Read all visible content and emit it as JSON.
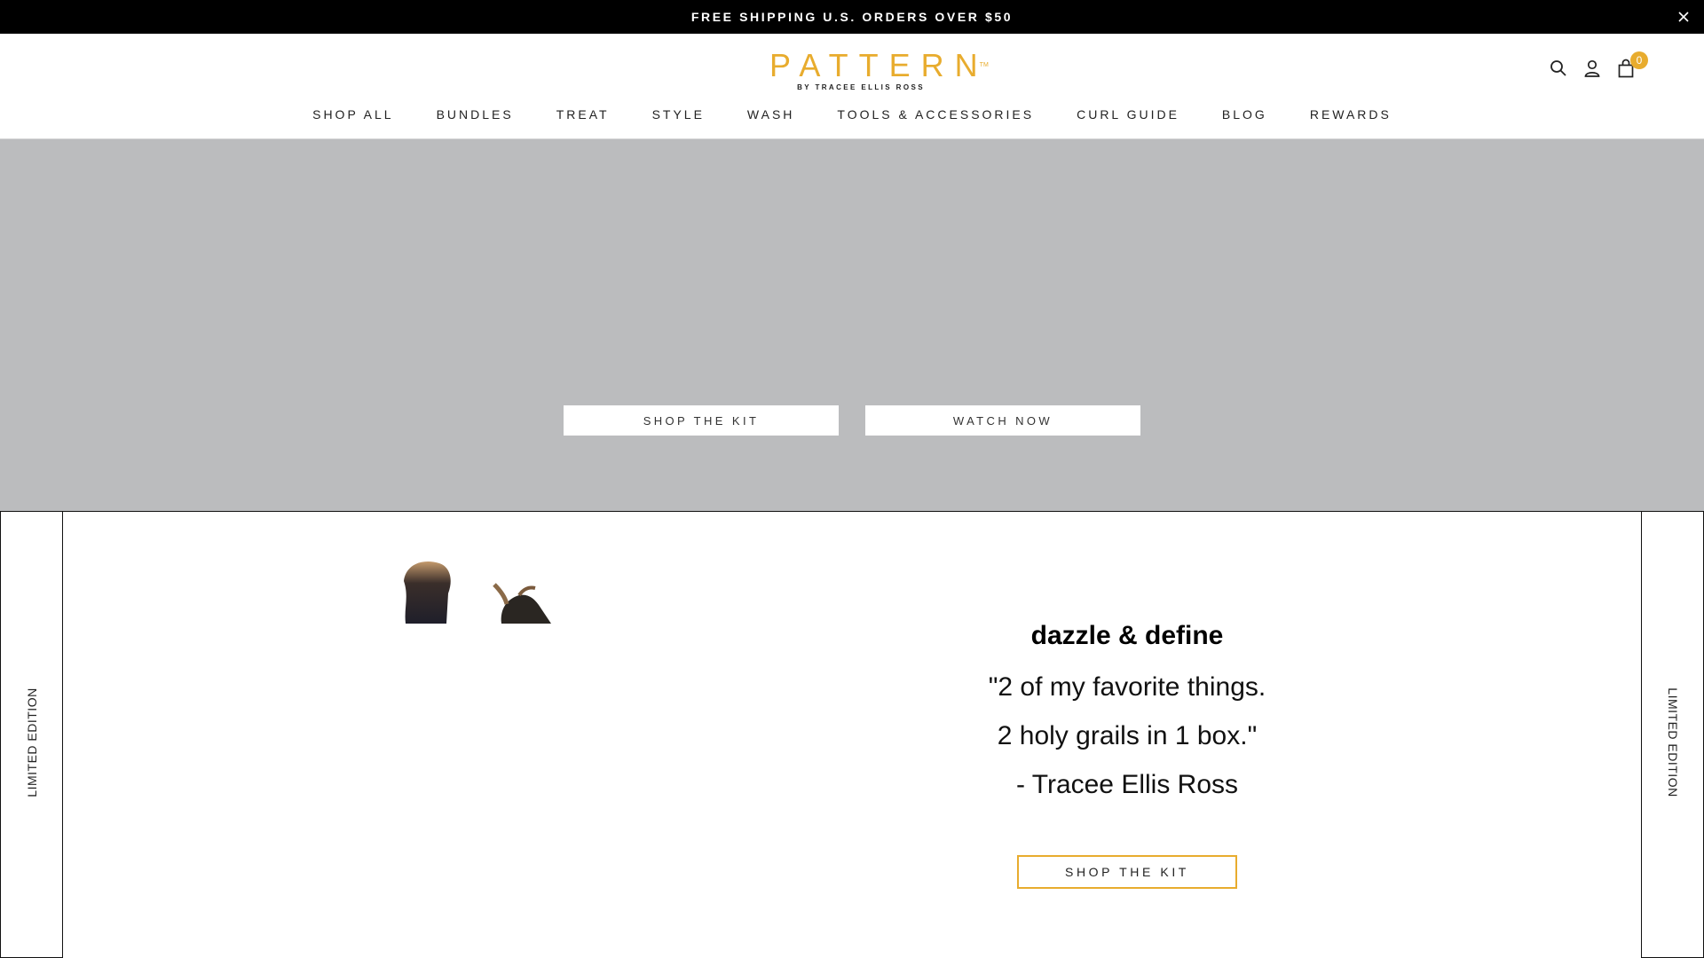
{
  "announcement": {
    "text": "FREE SHIPPING U.S. ORDERS OVER $50",
    "close_icon": "close-icon"
  },
  "brand": {
    "name": "PATTERN",
    "tm": "TM",
    "tagline": "BY TRACEE ELLIS ROSS",
    "color": "#e8ac2e"
  },
  "header": {
    "icons": [
      "search-icon",
      "account-icon",
      "cart-icon"
    ],
    "cart_count": "0"
  },
  "nav": {
    "items": [
      {
        "label": "SHOP ALL"
      },
      {
        "label": "BUNDLES"
      },
      {
        "label": "TREAT"
      },
      {
        "label": "STYLE"
      },
      {
        "label": "WASH"
      },
      {
        "label": "TOOLS & ACCESSORIES"
      },
      {
        "label": "CURL GUIDE"
      },
      {
        "label": "BLOG"
      },
      {
        "label": "REWARDS"
      }
    ]
  },
  "hero": {
    "background": "#bbbcbe",
    "primary_button": "SHOP THE KIT",
    "secondary_button": "WATCH NOW"
  },
  "promo": {
    "side_label_left": "LIMITED EDITION",
    "side_label_right": "LIMITED EDITION",
    "heading": "dazzle & define",
    "quote_line1": "\"2 of my favorite things.",
    "quote_line2": "2 holy grails in 1 box.\"",
    "attribution": "- Tracee Ellis Ross",
    "cta": "SHOP THE KIT",
    "accent": "#e8ac2e"
  }
}
